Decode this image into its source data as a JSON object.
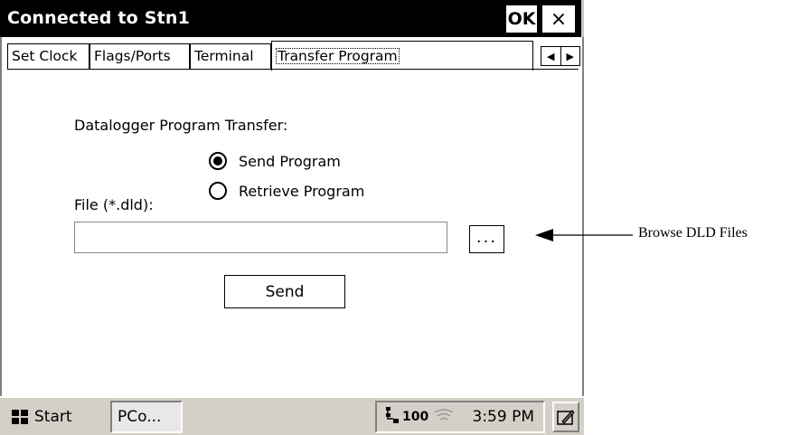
{
  "window": {
    "title": "Connected to Stn1",
    "ok_label": "OK",
    "close_glyph": "×"
  },
  "tabs": [
    {
      "label": "Set Clock",
      "active": false
    },
    {
      "label": "Flags/Ports",
      "active": false
    },
    {
      "label": "Terminal",
      "active": false
    },
    {
      "label": "Transfer Program",
      "active": true
    }
  ],
  "tab_scroll": {
    "left_glyph": "◀",
    "right_glyph": "▶"
  },
  "content": {
    "section_label": "Datalogger Program Transfer:",
    "radio_send_label": "Send Program",
    "radio_retrieve_label": "Retrieve Program",
    "selected_radio": "send",
    "file_label": "File (*.dld):",
    "file_value": "",
    "browse_label": "...",
    "send_button_label": "Send"
  },
  "taskbar": {
    "start_label": "Start",
    "task_item_label": "PCo...",
    "tray_icons": [
      "network-icon",
      "battery-100-icon",
      "wireless-icon"
    ],
    "tray_battery_text": "100",
    "clock": "3:59 PM",
    "input_panel_icon": "keyboard-pen-icon"
  },
  "annotation": {
    "text": "Browse DLD Files"
  }
}
